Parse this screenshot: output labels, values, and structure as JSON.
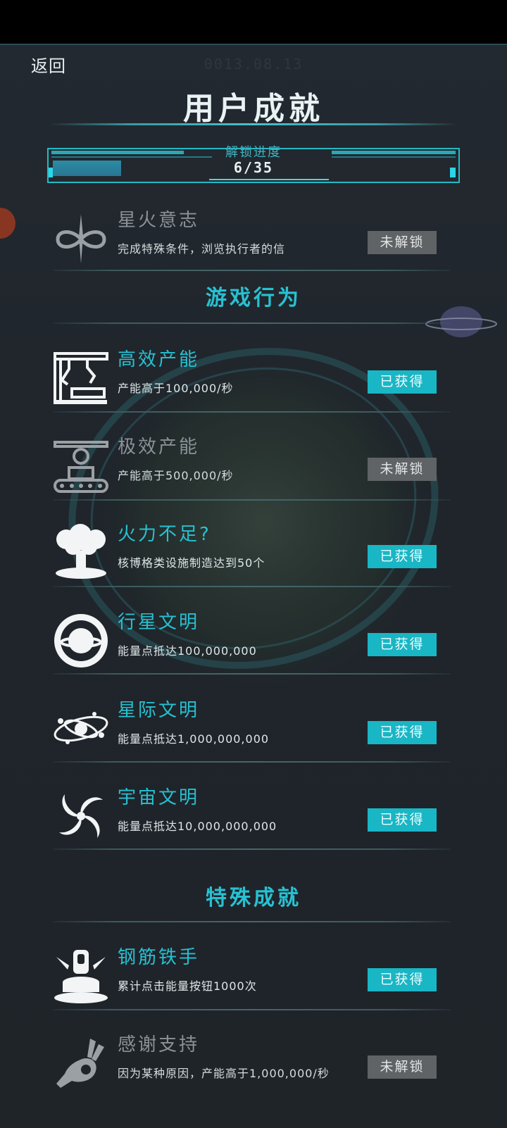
{
  "header": {
    "back_label": "返回",
    "date": "0013.08.13",
    "title": "用户成就"
  },
  "progress": {
    "label": "解锁进度",
    "text": "6/35",
    "value": 6,
    "total": 35
  },
  "items": [
    {
      "name": "星火意志",
      "desc": "完成特殊条件，浏览执行者的信",
      "status": "未解锁",
      "icon": "infinity-star-icon"
    },
    {
      "name": "高效产能",
      "desc": "产能高于100,000/秒",
      "status": "已获得",
      "icon": "robot-arm-icon"
    },
    {
      "name": "极效产能",
      "desc": "产能高于500,000/秒",
      "status": "未解锁",
      "icon": "gear-tank-icon"
    },
    {
      "name": "火力不足?",
      "desc": "核博格类设施制造达到50个",
      "status": "已获得",
      "icon": "mushroom-cloud-icon"
    },
    {
      "name": "行星文明",
      "desc": "能量点抵达100,000,000",
      "status": "已获得",
      "icon": "planet-ring-icon"
    },
    {
      "name": "星际文明",
      "desc": "能量点抵达1,000,000,000",
      "status": "已获得",
      "icon": "solar-system-icon"
    },
    {
      "name": "宇宙文明",
      "desc": "能量点抵达10,000,000,000",
      "status": "已获得",
      "icon": "galaxy-spiral-icon"
    },
    {
      "name": "钢筋铁手",
      "desc": "累计点击能量按钮1000次",
      "status": "已获得",
      "icon": "press-button-icon"
    },
    {
      "name": "感谢支持",
      "desc": "因为某种原因，产能高于1,000,000/秒",
      "status": "未解锁",
      "icon": "ok-hand-icon"
    }
  ],
  "sections": {
    "gameplay": "游戏行为",
    "special": "特殊成就"
  },
  "colors": {
    "accent": "#27c1d2",
    "button_obtained": "#19b6c5",
    "button_locked": "#5f6366",
    "background": "#1f252b"
  }
}
